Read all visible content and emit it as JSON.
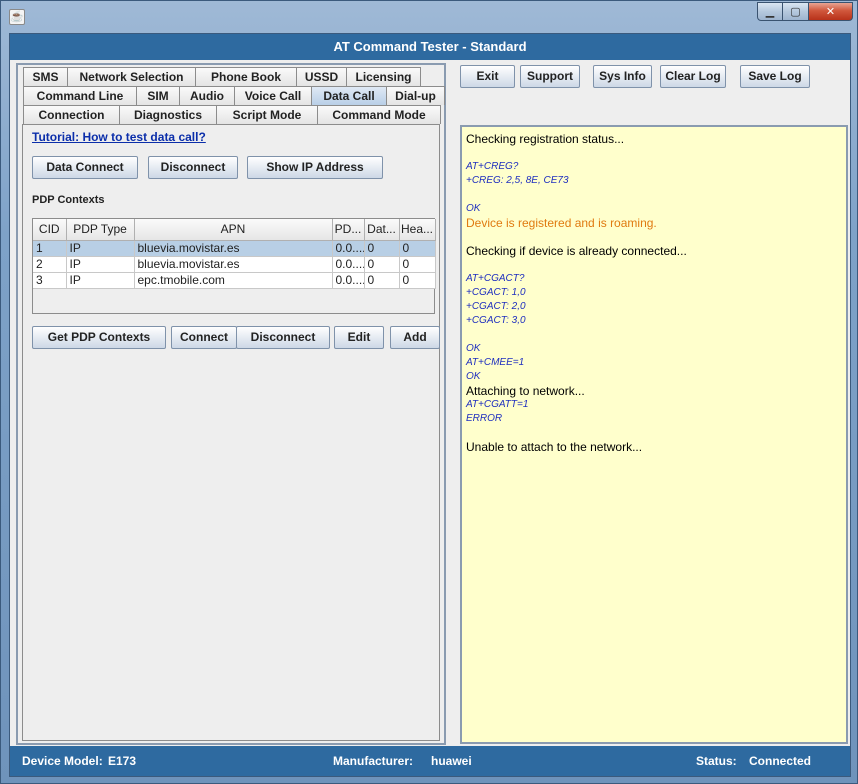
{
  "window": {
    "title": "AT Command Tester - Standard",
    "app_icon_glyph": "☕"
  },
  "tabs": {
    "row1": [
      {
        "label": "SMS"
      },
      {
        "label": "Network Selection"
      },
      {
        "label": "Phone Book"
      },
      {
        "label": "USSD"
      },
      {
        "label": "Licensing"
      }
    ],
    "row2": [
      {
        "label": "Command Line"
      },
      {
        "label": "SIM"
      },
      {
        "label": "Audio"
      },
      {
        "label": "Voice Call"
      },
      {
        "label": "Data Call",
        "active": true
      },
      {
        "label": "Dial-up"
      }
    ],
    "row3": [
      {
        "label": "Connection"
      },
      {
        "label": "Diagnostics"
      },
      {
        "label": "Script Mode"
      },
      {
        "label": "Command Mode"
      }
    ]
  },
  "data_call": {
    "tutorial_link": "Tutorial: How to test data call?",
    "data_connect_label": "Data Connect",
    "disconnect_label": "Disconnect",
    "show_ip_label": "Show IP Address",
    "pdp_section_title": "PDP Contexts",
    "table": {
      "columns": [
        "CID",
        "PDP Type",
        "APN",
        "PD...",
        "Dat...",
        "Hea..."
      ],
      "rows": [
        [
          "1",
          "IP",
          "bluevia.movistar.es",
          "0.0....",
          "0",
          "0"
        ],
        [
          "2",
          "IP",
          "bluevia.movistar.es",
          "0.0....",
          "0",
          "0"
        ],
        [
          "3",
          "IP",
          "epc.tmobile.com",
          "0.0....",
          "0",
          "0"
        ]
      ],
      "selected_row": 0
    },
    "get_pdp_label": "Get PDP Contexts",
    "connect_label": "Connect",
    "disconnect2_label": "Disconnect",
    "edit_label": "Edit",
    "add_label": "Add"
  },
  "toolbar": {
    "exit_label": "Exit",
    "support_label": "Support",
    "sysinfo_label": "Sys Info",
    "clearlog_label": "Clear Log",
    "savelog_label": "Save Log"
  },
  "log": [
    {
      "type": "info",
      "text": "Checking registration status..."
    },
    {
      "type": "gap",
      "text": ""
    },
    {
      "type": "cmd",
      "text": "AT+CREG?"
    },
    {
      "type": "cmd",
      "text": "+CREG: 2,5, 8E, CE73"
    },
    {
      "type": "gap",
      "text": ""
    },
    {
      "type": "cmd",
      "text": "OK"
    },
    {
      "type": "warn",
      "text": "Device is registered and is roaming."
    },
    {
      "type": "gap",
      "text": ""
    },
    {
      "type": "info",
      "text": "Checking if device is already connected..."
    },
    {
      "type": "gap",
      "text": ""
    },
    {
      "type": "cmd",
      "text": "AT+CGACT?"
    },
    {
      "type": "cmd",
      "text": "+CGACT: 1,0"
    },
    {
      "type": "cmd",
      "text": "+CGACT: 2,0"
    },
    {
      "type": "cmd",
      "text": "+CGACT: 3,0"
    },
    {
      "type": "gap",
      "text": ""
    },
    {
      "type": "cmd",
      "text": "OK"
    },
    {
      "type": "cmd",
      "text": "AT+CMEE=1"
    },
    {
      "type": "cmd",
      "text": "OK"
    },
    {
      "type": "info",
      "text": "Attaching to network..."
    },
    {
      "type": "cmd",
      "text": "AT+CGATT=1"
    },
    {
      "type": "cmd",
      "text": "ERROR"
    },
    {
      "type": "gap",
      "text": ""
    },
    {
      "type": "info",
      "text": "Unable to attach to the network..."
    }
  ],
  "status": {
    "model_label": "Device Model:",
    "model_value": "E173",
    "manufacturer_label": "Manufacturer:",
    "manufacturer_value": "huawei",
    "status_label": "Status:",
    "status_value": "Connected"
  },
  "colors": {
    "accent": "#2e6aa0",
    "log_bg": "#ffffcc",
    "cmd_text": "#1f2fbf",
    "warn_text": "#e07a10"
  }
}
